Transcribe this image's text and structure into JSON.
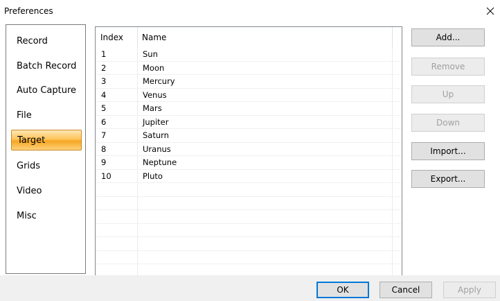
{
  "window": {
    "title": "Preferences"
  },
  "sidebar": {
    "items": [
      {
        "label": "Record",
        "selected": false
      },
      {
        "label": "Batch Record",
        "selected": false
      },
      {
        "label": "Auto Capture",
        "selected": false
      },
      {
        "label": "File",
        "selected": false
      },
      {
        "label": "Target",
        "selected": true
      },
      {
        "label": "Grids",
        "selected": false
      },
      {
        "label": "Video",
        "selected": false
      },
      {
        "label": "Misc",
        "selected": false
      }
    ]
  },
  "list": {
    "columns": [
      "Index",
      "Name"
    ],
    "rows": [
      {
        "index": "1",
        "name": "Sun"
      },
      {
        "index": "2",
        "name": "Moon"
      },
      {
        "index": "3",
        "name": "Mercury"
      },
      {
        "index": "4",
        "name": "Venus"
      },
      {
        "index": "5",
        "name": "Mars"
      },
      {
        "index": "6",
        "name": "Jupiter"
      },
      {
        "index": "7",
        "name": "Saturn"
      },
      {
        "index": "8",
        "name": "Uranus"
      },
      {
        "index": "9",
        "name": "Neptune"
      },
      {
        "index": "10",
        "name": "Pluto"
      }
    ]
  },
  "actions": {
    "add": "Add...",
    "remove": "Remove",
    "up": "Up",
    "down": "Down",
    "import": "Import...",
    "export": "Export..."
  },
  "footer": {
    "ok": "OK",
    "cancel": "Cancel",
    "apply": "Apply"
  },
  "colors": {
    "selected_item": "#f5a623",
    "primary_border": "#0078d7",
    "disabled_text": "#a0a0a0"
  }
}
